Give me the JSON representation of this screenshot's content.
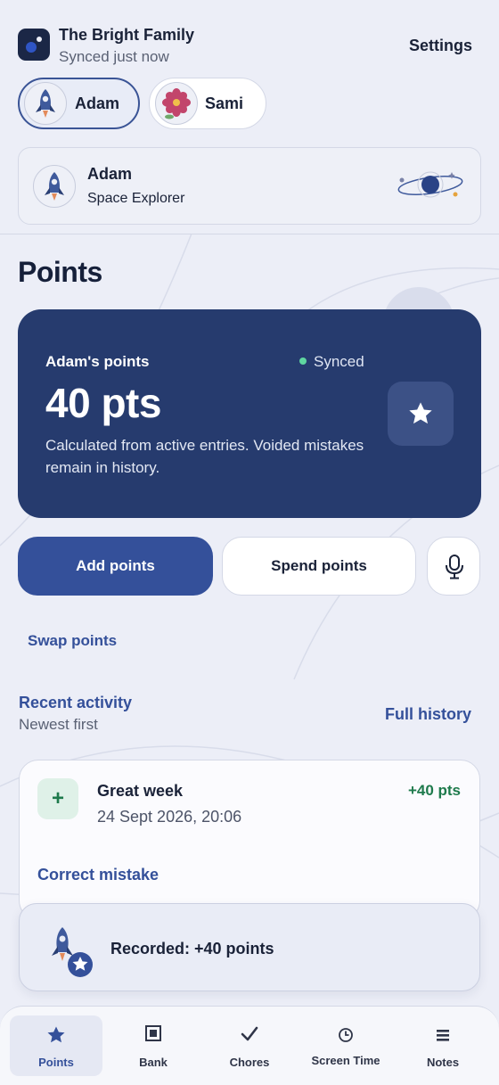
{
  "header": {
    "family_name": "The Bright Family",
    "sync_status": "Synced just now",
    "settings_label": "Settings"
  },
  "profiles": [
    {
      "name": "Adam",
      "avatar": "rocket-icon",
      "active": true
    },
    {
      "name": "Sami",
      "avatar": "flower-icon",
      "active": false
    }
  ],
  "profile_card": {
    "name": "Adam",
    "theme": "Space Explorer",
    "art": "planet-icon"
  },
  "page": {
    "title": "Points"
  },
  "points_card": {
    "title": "Adam's points",
    "sync_label": "Synced",
    "value": "40 pts",
    "description": "Calculated from active entries. Voided mistakes remain in history.",
    "icon": "star-icon"
  },
  "actions": {
    "add_label": "Add points",
    "spend_label": "Spend points",
    "mic_icon": "microphone-icon",
    "swap_label": "Swap points"
  },
  "recent": {
    "title": "Recent activity",
    "subtitle": "Newest first",
    "full_history_label": "Full history",
    "items": [
      {
        "title": "Great week",
        "date": "24 Sept 2026, 20:06",
        "points": "+40 pts",
        "action": "Correct mistake",
        "icon_glyph": "+"
      }
    ]
  },
  "toast": {
    "text": "Recorded: +40 points"
  },
  "tabs": [
    {
      "label": "Points",
      "icon": "star-icon",
      "active": true
    },
    {
      "label": "Bank",
      "icon": "bank-icon",
      "active": false
    },
    {
      "label": "Chores",
      "icon": "check-icon",
      "active": false
    },
    {
      "label": "Screen Time",
      "icon": "clock-icon",
      "active": false
    },
    {
      "label": "Notes",
      "icon": "notes-icon",
      "active": false
    }
  ],
  "colors": {
    "background": "#eceef7",
    "primary": "#34509a",
    "card_dark": "#263b6e",
    "positive": "#1e7a4c",
    "synced_dot": "#5fd6a0"
  }
}
